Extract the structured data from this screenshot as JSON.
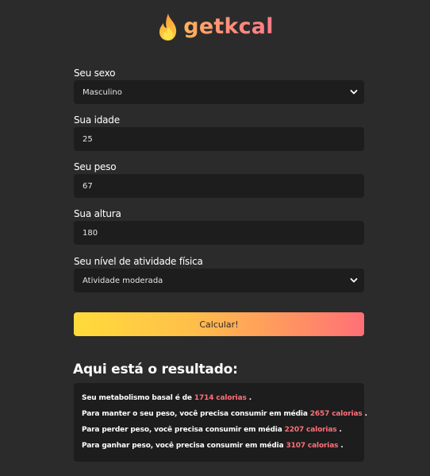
{
  "brand": {
    "name": "getkcal",
    "flame_colors": [
      "#ffd23f",
      "#ff9a3c",
      "#ff6b6b"
    ]
  },
  "form": {
    "sex": {
      "label": "Seu sexo",
      "value": "Masculino"
    },
    "age": {
      "label": "Sua idade",
      "value": "25"
    },
    "weight": {
      "label": "Seu peso",
      "value": "67"
    },
    "height": {
      "label": "Sua altura",
      "value": "180"
    },
    "activity": {
      "label": "Seu nível de atividade física",
      "value": "Atividade moderada"
    }
  },
  "calculate_button": {
    "label": "Calcular!",
    "gradient": [
      "#ffdb3a",
      "#ff6f77"
    ]
  },
  "result": {
    "title": "Aqui está o resultado:",
    "highlight_color": "#ff6f7a",
    "lines": [
      {
        "before": "Seu metabolismo basal é de ",
        "value": "1714 calorias",
        "after": " ."
      },
      {
        "before": "Para manter o seu peso, você precisa consumir em média ",
        "value": "2657 calorias",
        "after": " ."
      },
      {
        "before": "Para perder peso, você precisa consumir em média ",
        "value": "2207 calorias",
        "after": " ."
      },
      {
        "before": "Para ganhar peso, você precisa consumir em média ",
        "value": "3107 calorias",
        "after": " ."
      }
    ]
  }
}
